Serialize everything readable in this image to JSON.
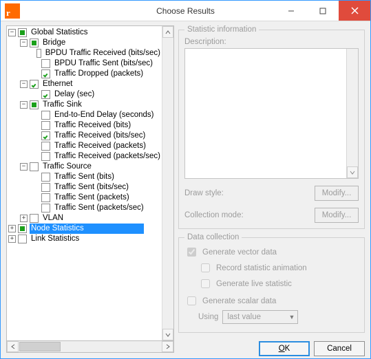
{
  "window": {
    "title": "Choose Results"
  },
  "titlebar_buttons": {
    "min": "Minimize",
    "max": "Maximize",
    "close": "Close"
  },
  "tree": {
    "global": {
      "label": "Global Statistics"
    },
    "bridge": {
      "label": "Bridge",
      "items": [
        "BPDU Traffic Received (bits/sec)",
        "BPDU Traffic Sent (bits/sec)",
        "Traffic Dropped (packets)"
      ]
    },
    "ethernet": {
      "label": "Ethernet",
      "items": [
        "Delay (sec)"
      ]
    },
    "sink": {
      "label": "Traffic Sink",
      "items": [
        "End-to-End Delay (seconds)",
        "Traffic Received (bits)",
        "Traffic Received (bits/sec)",
        "Traffic Received (packets)",
        "Traffic Received (packets/sec)"
      ]
    },
    "source": {
      "label": "Traffic Source",
      "items": [
        "Traffic Sent (bits)",
        "Traffic Sent (bits/sec)",
        "Traffic Sent (packets)",
        "Traffic Sent (packets/sec)"
      ]
    },
    "vlan": {
      "label": "VLAN"
    },
    "node": {
      "label": "Node Statistics"
    },
    "link": {
      "label": "Link Statistics"
    }
  },
  "info": {
    "legend": "Statistic information",
    "description_label": "Description:",
    "draw_style_label": "Draw style:",
    "collection_mode_label": "Collection mode:",
    "modify_label": "Modify..."
  },
  "collect": {
    "legend": "Data collection",
    "vector": "Generate vector data",
    "record_anim": "Record statistic animation",
    "live": "Generate live statistic",
    "scalar": "Generate scalar data",
    "using_label": "Using",
    "using_value": "last value"
  },
  "buttons": {
    "ok": "OK",
    "cancel": "Cancel"
  }
}
